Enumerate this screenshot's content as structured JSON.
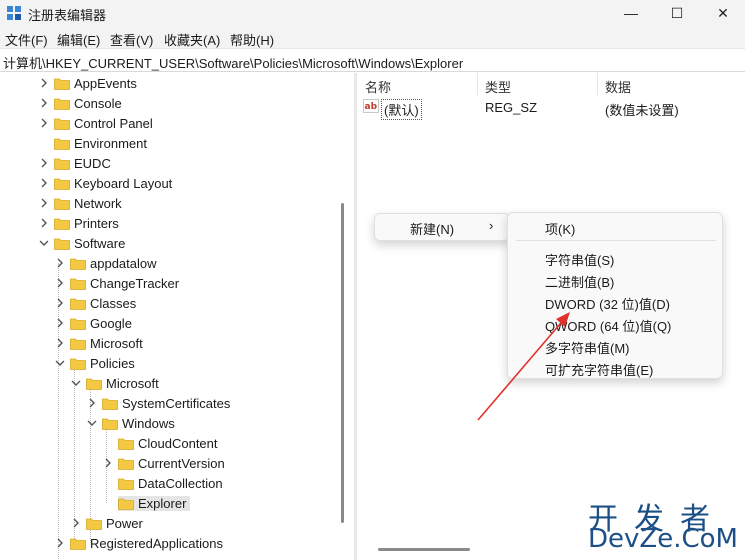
{
  "window": {
    "title": "注册表编辑器",
    "minimize": "—",
    "maximize": "☐",
    "close": "✕"
  },
  "menubar": [
    "文件(F)",
    "编辑(E)",
    "查看(V)",
    "收藏夹(A)",
    "帮助(H)"
  ],
  "address": "计算机\\HKEY_CURRENT_USER\\Software\\Policies\\Microsoft\\Windows\\Explorer",
  "tree": {
    "items": [
      {
        "label": "AppEvents",
        "expanded": false
      },
      {
        "label": "Console",
        "expanded": false
      },
      {
        "label": "Control Panel",
        "expanded": false
      },
      {
        "label": "Environment",
        "expanded": null
      },
      {
        "label": "EUDC",
        "expanded": false
      },
      {
        "label": "Keyboard Layout",
        "expanded": false
      },
      {
        "label": "Network",
        "expanded": false
      },
      {
        "label": "Printers",
        "expanded": false
      },
      {
        "label": "Software",
        "expanded": true
      },
      {
        "label": "appdatalow",
        "expanded": false
      },
      {
        "label": "ChangeTracker",
        "expanded": false
      },
      {
        "label": "Classes",
        "expanded": false
      },
      {
        "label": "Google",
        "expanded": false
      },
      {
        "label": "Microsoft",
        "expanded": false
      },
      {
        "label": "Policies",
        "expanded": true
      },
      {
        "label": "Microsoft",
        "expanded": true
      },
      {
        "label": "SystemCertificates",
        "expanded": false
      },
      {
        "label": "Windows",
        "expanded": true
      },
      {
        "label": "CloudContent",
        "expanded": null
      },
      {
        "label": "CurrentVersion",
        "expanded": false
      },
      {
        "label": "DataCollection",
        "expanded": null
      },
      {
        "label": "Explorer",
        "expanded": null,
        "selected": true
      },
      {
        "label": "Power",
        "expanded": false
      },
      {
        "label": "RegisteredApplications",
        "expanded": false
      }
    ]
  },
  "list": {
    "columns": [
      "名称",
      "类型",
      "数据"
    ],
    "rows": [
      {
        "name": "(默认)",
        "type": "REG_SZ",
        "data": "(数值未设置)",
        "icon": "string-value-icon"
      }
    ]
  },
  "context_menu": {
    "main_label": "新建(N)",
    "main_arrow": "›",
    "submenu": [
      "项(K)",
      "字符串值(S)",
      "二进制值(B)",
      "DWORD (32 位)值(D)",
      "QWORD (64 位)值(Q)",
      "多字符串值(M)",
      "可扩充字符串值(E)"
    ]
  },
  "annotation": {
    "arrow_color": "#e0322c"
  },
  "watermark": {
    "cn": "开发者",
    "en": "DevZe.CoM"
  },
  "colors": {
    "folder": "#f5c842",
    "selection": "#e5e5e5",
    "watermark": "#1c4f86"
  }
}
